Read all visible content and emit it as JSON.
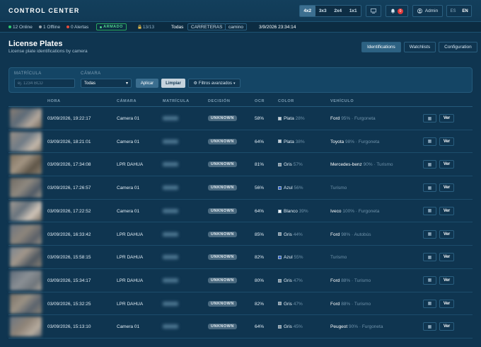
{
  "header": {
    "brand": "CONTROL CENTER",
    "grid_options": [
      "4x2",
      "3x3",
      "2x4",
      "1x1"
    ],
    "grid_active": 0,
    "notifications_count": "0",
    "user": "Admin",
    "languages": [
      "ES",
      "EN"
    ],
    "language_active": 1
  },
  "status": {
    "online": "12 Online",
    "offline": "1 Offline",
    "alerts": "0 Alertas",
    "armed": "ARMADO",
    "locks": "13/13",
    "filter_all": "Todas",
    "filter_roads": "CARRETERAS",
    "filter_path": "camino",
    "datetime": "3/9/2026 23:34:14",
    "colors": {
      "online": "#2ecc71",
      "offline": "#9aa5ad",
      "alerts": "#e74c3c",
      "armed": "#4fd38b"
    }
  },
  "page": {
    "title": "License Plates",
    "subtitle": "License plate identifications by camera",
    "tabs": [
      "Identifications",
      "Watchlists",
      "Configuration"
    ],
    "active_tab": 0
  },
  "filters": {
    "plate_label": "MATRÍCULA",
    "plate_placeholder": "ej. 1234 BCD",
    "camera_label": "CÁMARA",
    "camera_value": "Todas",
    "apply": "Aplicar",
    "clear": "Limpiar",
    "advanced": "Filtros avanzados"
  },
  "table": {
    "columns": {
      "time": "HORA",
      "camera": "CÁMARA",
      "plate": "MATRÍCULA",
      "decision": "DECISIÓN",
      "ocr": "OCR",
      "color": "COLOR",
      "vehicle": "VEHÍCULO"
    },
    "view_label": "Ver",
    "rows": [
      {
        "time": "03/09/2026, 19:22:17",
        "camera": "Camera 01",
        "decision": "UNKNOWN",
        "ocr": "58%",
        "color": "Plata",
        "color_hex": "#c9ced2",
        "color_conf": "28%",
        "brand": "Ford",
        "brand_conf": "95%",
        "type": "Furgoneta"
      },
      {
        "time": "03/09/2026, 18:21:01",
        "camera": "Camera 01",
        "decision": "UNKNOWN",
        "ocr": "64%",
        "color": "Plata",
        "color_hex": "#c9ced2",
        "color_conf": "38%",
        "brand": "Toyota",
        "brand_conf": "98%",
        "type": "Furgoneta"
      },
      {
        "time": "03/09/2026, 17:34:08",
        "camera": "LPR DAHUA",
        "decision": "UNKNOWN",
        "ocr": "81%",
        "color": "Gris",
        "color_hex": "#8a949b",
        "color_conf": "57%",
        "brand": "Mercedes-benz",
        "brand_conf": "90%",
        "type": "Turismo"
      },
      {
        "time": "03/09/2026, 17:26:57",
        "camera": "Camera 01",
        "decision": "UNKNOWN",
        "ocr": "56%",
        "color": "Azul",
        "color_hex": "#2f5fd0",
        "color_conf": "56%",
        "brand": "",
        "brand_conf": "",
        "type": "Turismo"
      },
      {
        "time": "03/09/2026, 17:22:52",
        "camera": "Camera 01",
        "decision": "UNKNOWN",
        "ocr": "64%",
        "color": "Blanco",
        "color_hex": "#ffffff",
        "color_conf": "39%",
        "brand": "Iveco",
        "brand_conf": "100%",
        "type": "Furgoneta"
      },
      {
        "time": "03/09/2026, 16:33:42",
        "camera": "LPR DAHUA",
        "decision": "UNKNOWN",
        "ocr": "85%",
        "color": "Gris",
        "color_hex": "#8a949b",
        "color_conf": "44%",
        "brand": "Ford",
        "brand_conf": "98%",
        "type": "Autobús"
      },
      {
        "time": "03/09/2026, 15:58:15",
        "camera": "LPR DAHUA",
        "decision": "UNKNOWN",
        "ocr": "82%",
        "color": "Azul",
        "color_hex": "#2f5fd0",
        "color_conf": "55%",
        "brand": "",
        "brand_conf": "",
        "type": "Turismo"
      },
      {
        "time": "03/09/2026, 15:34:17",
        "camera": "LPR DAHUA",
        "decision": "UNKNOWN",
        "ocr": "80%",
        "color": "Gris",
        "color_hex": "#8a949b",
        "color_conf": "47%",
        "brand": "Ford",
        "brand_conf": "88%",
        "type": "Turismo"
      },
      {
        "time": "03/09/2026, 15:32:25",
        "camera": "LPR DAHUA",
        "decision": "UNKNOWN",
        "ocr": "82%",
        "color": "Gris",
        "color_hex": "#8a949b",
        "color_conf": "47%",
        "brand": "Ford",
        "brand_conf": "88%",
        "type": "Turismo"
      },
      {
        "time": "03/09/2026, 15:13:10",
        "camera": "Camera 01",
        "decision": "UNKNOWN",
        "ocr": "64%",
        "color": "Gris",
        "color_hex": "#8a949b",
        "color_conf": "45%",
        "brand": "Peugeot",
        "brand_conf": "90%",
        "type": "Furgoneta"
      }
    ]
  },
  "icons": {
    "monitor": "monitor-icon",
    "bell": "bell-icon",
    "user": "user-icon",
    "lock": "lock-icon",
    "gear": "gear-icon",
    "camera": "camera-icon",
    "chevron": "chevron-down-icon"
  }
}
